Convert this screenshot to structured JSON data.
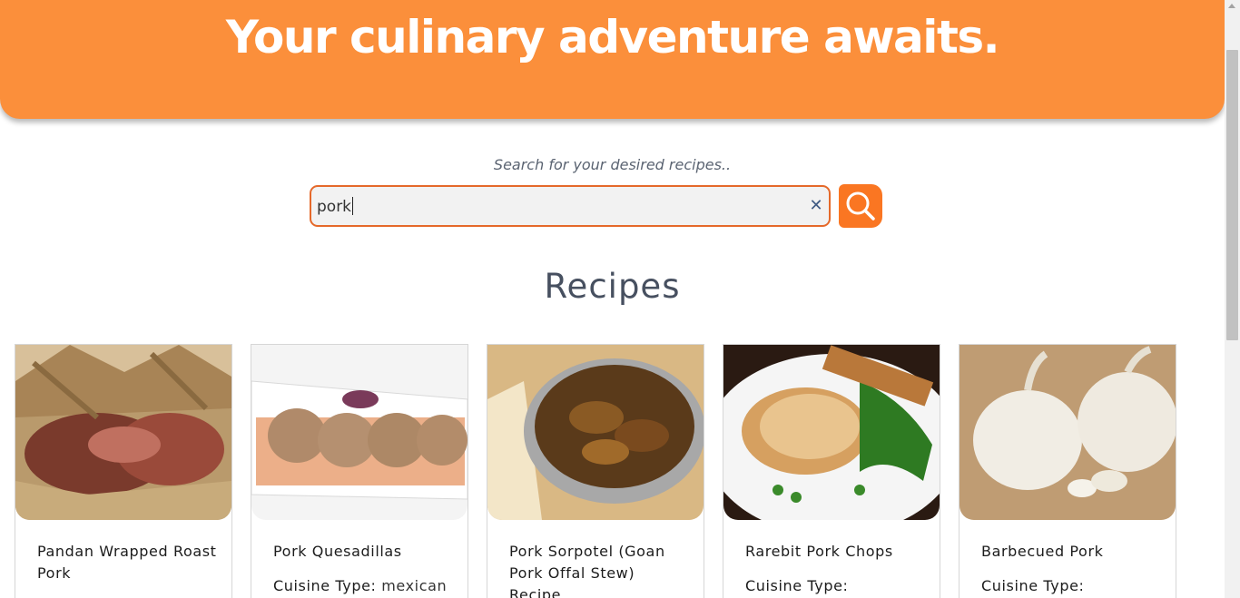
{
  "hero": {
    "title": "Your culinary adventure awaits."
  },
  "search": {
    "hint": "Search for your desired recipes..",
    "value": "pork",
    "clear_icon": "close-icon",
    "submit_icon": "search-icon"
  },
  "section": {
    "title": "Recipes"
  },
  "cuisine_label": "Cuisine Type:",
  "recipes": [
    {
      "name": "Pandan Wrapped Roast Pork",
      "cuisine": ""
    },
    {
      "name": "Pork Quesadillas",
      "cuisine": "mexican"
    },
    {
      "name": "Pork Sorpotel (Goan Pork Offal Stew) Recipe",
      "cuisine": ""
    },
    {
      "name": "Rarebit Pork Chops",
      "cuisine": ""
    },
    {
      "name": "Barbecued Pork",
      "cuisine": ""
    }
  ],
  "colors": {
    "accent": "#fb8f3b",
    "button": "#fa7622",
    "border": "#e5692a"
  }
}
